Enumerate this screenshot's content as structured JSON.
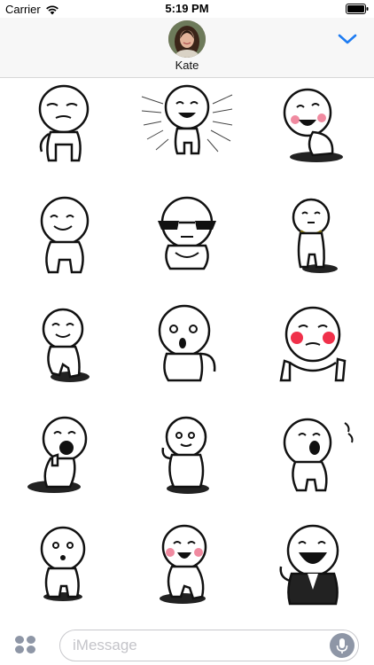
{
  "status_bar": {
    "carrier": "Carrier",
    "time": "5:19 PM"
  },
  "header": {
    "contact_name": "Kate",
    "collapse_icon": "chevron-down-icon",
    "accent_color": "#1e7cf2"
  },
  "stickers": [
    {
      "pose": "smug-shrug"
    },
    {
      "pose": "excited-burst"
    },
    {
      "pose": "laughing-blush"
    },
    {
      "pose": "smiling-standing"
    },
    {
      "pose": "cool-sunglasses"
    },
    {
      "pose": "shy-necklace"
    },
    {
      "pose": "happy-walking"
    },
    {
      "pose": "surprised-pointing"
    },
    {
      "pose": "peace-sign-blush"
    },
    {
      "pose": "thumbs-up-laughing"
    },
    {
      "pose": "flexing-arm"
    },
    {
      "pose": "shouting"
    },
    {
      "pose": "whistling"
    },
    {
      "pose": "dancing-blush"
    },
    {
      "pose": "big-laugh-suit"
    }
  ],
  "input_bar": {
    "apps_icon": "apps-grid-icon",
    "placeholder": "iMessage",
    "mic_icon": "microphone-icon"
  }
}
